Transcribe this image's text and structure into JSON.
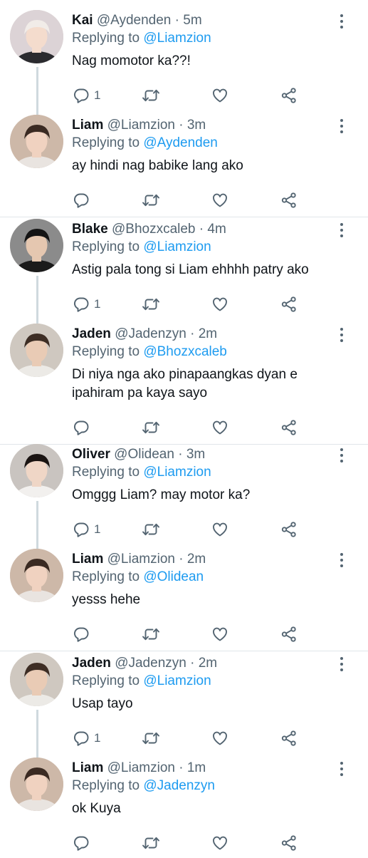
{
  "labels": {
    "replying_to": "Replying to",
    "dot": "·"
  },
  "colors": {
    "mention": "#1d9bf0",
    "secondary": "#536471",
    "thread_line": "#cfd9de"
  },
  "icons": [
    "reply-icon",
    "retweet-icon",
    "like-icon",
    "share-icon",
    "more-icon"
  ],
  "tweets": [
    {
      "name": "Kai",
      "handle": "@Aydenden",
      "time": "5m",
      "replying_to": "@Liamzion",
      "lines": [
        "Nag momotor ka??!"
      ],
      "reply_count": "1"
    },
    {
      "name": "Liam",
      "handle": "@Liamzion",
      "time": "3m",
      "replying_to": "@Aydenden",
      "lines": [
        "ay hindi nag babike lang ako"
      ],
      "reply_count": ""
    },
    {
      "name": "Blake",
      "handle": "@Bhozxcaleb",
      "time": "4m",
      "replying_to": "@Liamzion",
      "lines": [
        "Astig pala tong si Liam ehhhh patry ako"
      ],
      "reply_count": "1"
    },
    {
      "name": "Jaden",
      "handle": "@Jadenzyn",
      "time": "2m",
      "replying_to": "@Bhozxcaleb",
      "lines": [
        "Di niya nga ako pinapaangkas dyan e",
        "ipahiram pa kaya sayo"
      ],
      "reply_count": ""
    },
    {
      "name": "Oliver",
      "handle": "@Olidean",
      "time": "3m",
      "replying_to": "@Liamzion",
      "lines": [
        "Omggg Liam? may motor ka?"
      ],
      "reply_count": "1"
    },
    {
      "name": "Liam",
      "handle": "@Liamzion",
      "time": "2m",
      "replying_to": "@Olidean",
      "lines": [
        "yesss hehe"
      ],
      "reply_count": ""
    },
    {
      "name": "Jaden",
      "handle": "@Jadenzyn",
      "time": "2m",
      "replying_to": "@Liamzion",
      "lines": [
        "Usap tayo"
      ],
      "reply_count": "1"
    },
    {
      "name": "Liam",
      "handle": "@Liamzion",
      "time": "1m",
      "replying_to": "@Jadenzyn",
      "lines": [
        "ok Kuya"
      ],
      "reply_count": ""
    }
  ]
}
